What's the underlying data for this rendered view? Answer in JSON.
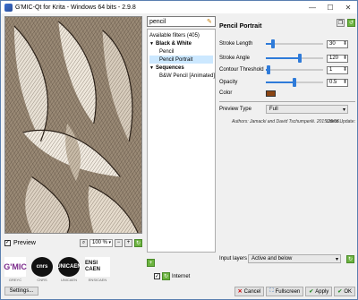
{
  "window": {
    "title": "G'MIC-Qt for Krita - Windows 64 bits - 2.9.8",
    "min_label": "—",
    "max_label": "☐",
    "close_label": "✕"
  },
  "preview": {
    "checkbox_label": "Preview",
    "checkbox_checked": true,
    "zoom_value": "100 %"
  },
  "logos": [
    {
      "mark": "G'MIC",
      "caption": "GREYC"
    },
    {
      "mark": "cnrs",
      "caption": "CNRS"
    },
    {
      "mark": "UNICAEN",
      "caption": "UNICAEN"
    },
    {
      "mark": "ENSI CAEN",
      "caption": "ENSICAEN"
    }
  ],
  "settings_button": "Settings...",
  "filters": {
    "search_value": "pencil",
    "header": "Available filters (405)",
    "items": [
      {
        "label": "Black & White",
        "type": "category",
        "expanded": true
      },
      {
        "label": "Pencil",
        "type": "filter",
        "selected": false
      },
      {
        "label": "Pencil Portrait",
        "type": "filter",
        "selected": true
      },
      {
        "label": "Sequences",
        "type": "category",
        "expanded": true
      },
      {
        "label": "B&W Pencil [Animated]",
        "type": "filter",
        "selected": false
      }
    ],
    "internet_label": "Internet"
  },
  "params": {
    "title": "Pencil Portrait",
    "rows": [
      {
        "label": "Stroke Length",
        "value": "30",
        "fraction": 0.12
      },
      {
        "label": "Stroke Angle",
        "value": "120",
        "fraction": 0.6
      },
      {
        "label": "Contour Threshold",
        "value": "1",
        "fraction": 0.05
      },
      {
        "label": "Opacity",
        "value": "0.5",
        "fraction": 0.5
      }
    ],
    "color_label": "Color",
    "color_value": "#8b4513",
    "preview_type_label": "Preview Type",
    "preview_type_value": "Full",
    "authors": "Authors: Jamacki and David Tschumperlé. 2015/29/06.",
    "latest_update": "Latest Update:"
  },
  "input_layers": {
    "label": "Input layers",
    "value": "Active and below"
  },
  "buttons": {
    "cancel": "Cancel",
    "fullscreen": "Fullscreen",
    "apply": "Apply",
    "ok": "OK"
  }
}
